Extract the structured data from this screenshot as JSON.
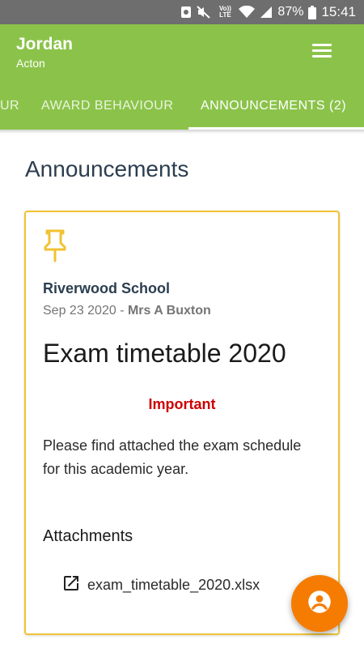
{
  "status_bar": {
    "battery_percent": "87%",
    "time": "15:41",
    "volte": "Vo)) LTE"
  },
  "header": {
    "student_name": "Jordan",
    "student_surname": "Acton"
  },
  "tabs": [
    {
      "label": "UR",
      "active": false
    },
    {
      "label": "AWARD BEHAVIOUR",
      "active": false
    },
    {
      "label": "ANNOUNCEMENTS (2)",
      "active": true
    }
  ],
  "page_title": "Announcements",
  "announcement": {
    "school": "Riverwood School",
    "date": "Sep 23 2020",
    "separator": " - ",
    "author": "Mrs A Buxton",
    "title": "Exam timetable 2020",
    "priority": "Important",
    "body": "Please find attached the exam schedule for this academic year.",
    "attachments_heading": "Attachments",
    "attachments": [
      {
        "filename": "exam_timetable_2020.xlsx"
      }
    ]
  },
  "colors": {
    "brand_green": "#8bc34a",
    "card_border": "#f1c232",
    "important_red": "#cc0000",
    "fab_orange": "#f57c00"
  },
  "icons": {
    "pin": "pushpin-icon",
    "menu": "hamburger-menu-icon",
    "attachment": "open-external-icon",
    "fab": "account-circle-icon"
  }
}
